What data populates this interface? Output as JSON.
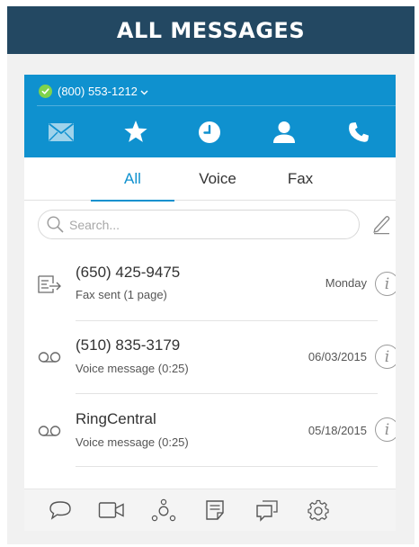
{
  "banner": {
    "title": "ALL MESSAGES"
  },
  "colors": {
    "banner_bg": "#234862",
    "brand_blue": "#0f91cf",
    "status_green": "#7fd34b"
  },
  "account": {
    "phone": "(800) 553-1212",
    "status_icon": "check-circle-icon",
    "menu_icon": "chevron-down-icon"
  },
  "nav": [
    {
      "name": "messages",
      "icon": "envelope-icon",
      "active": true
    },
    {
      "name": "favorites",
      "icon": "star-icon"
    },
    {
      "name": "recents",
      "icon": "clock-icon"
    },
    {
      "name": "contacts",
      "icon": "person-icon"
    },
    {
      "name": "dialer",
      "icon": "phone-icon"
    }
  ],
  "tabs": [
    {
      "label": "All",
      "active": true
    },
    {
      "label": "Voice"
    },
    {
      "label": "Fax"
    }
  ],
  "search": {
    "placeholder": "Search...",
    "value": ""
  },
  "messages": [
    {
      "type": "fax",
      "icon": "fax-sent-icon",
      "name": "(650) 425-9475",
      "subtitle": "Fax sent (1 page)",
      "date": "Monday"
    },
    {
      "type": "voice",
      "icon": "voicemail-icon",
      "name": "(510) 835-3179",
      "subtitle": "Voice message (0:25)",
      "date": "06/03/2015"
    },
    {
      "type": "voice",
      "icon": "voicemail-icon",
      "name": "RingCentral",
      "subtitle": "Voice message (0:25)",
      "date": "05/18/2015"
    }
  ],
  "bottom_nav": [
    {
      "name": "chat",
      "icon": "chat-bubble-icon"
    },
    {
      "name": "video",
      "icon": "video-camera-icon"
    },
    {
      "name": "conference",
      "icon": "conference-icon"
    },
    {
      "name": "notes",
      "icon": "note-icon"
    },
    {
      "name": "text",
      "icon": "message-icon"
    },
    {
      "name": "settings",
      "icon": "gear-icon"
    }
  ]
}
